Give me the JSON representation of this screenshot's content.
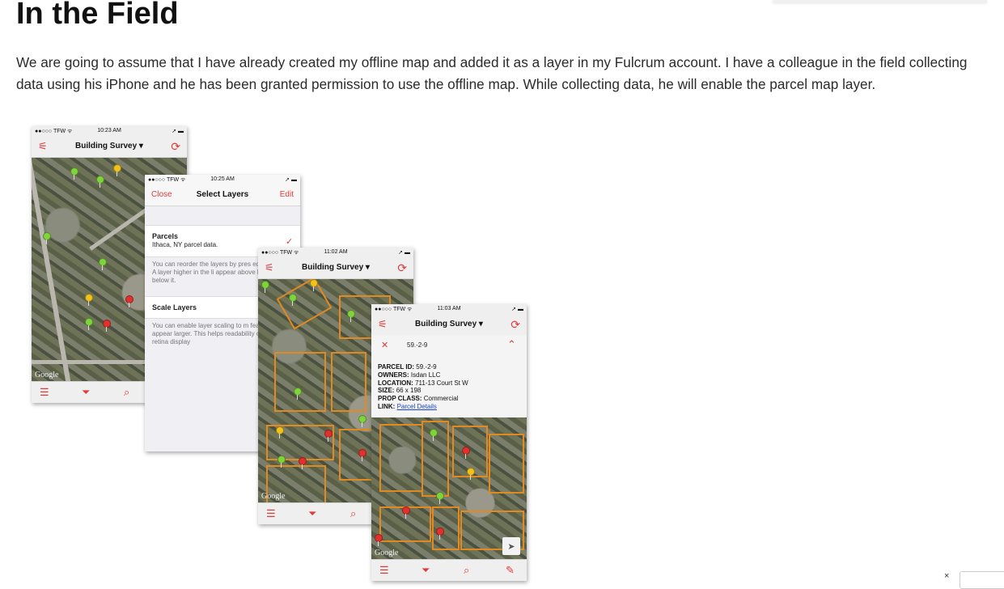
{
  "article": {
    "heading": "In the Field",
    "intro": "We are going to assume that I have already created my offline map and added it as a layer in my Fulcrum account. I have a colleague in the field collecting data using his iPhone and he has been granted permission to use the offline map. While collecting data, he will enable the parcel map layer."
  },
  "phone1": {
    "carrier": "●●○○○ TFW ᯤ",
    "time": "10:23 AM",
    "title": "Building Survey ▾",
    "google": "Google"
  },
  "phone2": {
    "carrier": "●●○○○ TFW ᯤ",
    "time": "10:25 AM",
    "close": "Close",
    "title": "Select Layers",
    "edit": "Edit",
    "layer_name": "Parcels",
    "layer_desc": "Ithaca, NY parcel data.",
    "reorder_text": "You can reorder the layers by pres edit button. A layer higher in the li appear above layers below it.",
    "scale_label": "Scale Layers",
    "scale_text": "You can enable layer scaling to m features appear larger. This helps readability of text on retina display"
  },
  "phone3": {
    "carrier": "●●○○○ TFW ᯤ",
    "time": "11:02 AM",
    "title": "Building Survey ▾",
    "google": "Google"
  },
  "phone4": {
    "carrier": "●●○○○ TFW ᯤ",
    "time": "11:03 AM",
    "title": "Building Survey ▾",
    "parcel_short": "59.-2-9",
    "parcel_id_label": "PARCEL ID:",
    "parcel_id": "59.-2-9",
    "owners_label": "OWNERS:",
    "owners": "Isdan LLC",
    "location_label": "LOCATION:",
    "location": "711-13 Court St W",
    "size_label": "SIZE:",
    "size": "66 x 198",
    "prop_label": "PROP CLASS:",
    "prop": "Commercial",
    "link_label": "LINK:",
    "link": "Parcel Details",
    "google": "Google"
  },
  "icons": {
    "settings": "⚟",
    "refresh": "⟳",
    "list": "☰",
    "filter": "⏷",
    "search": "⌕",
    "check": "✓",
    "close": "✕",
    "chevron_up": "⌃",
    "pencil": "✎",
    "locate": "➤",
    "battery": "➚ ▬"
  },
  "corner": {
    "close": "×"
  },
  "colors": {
    "accent": "#e23a3a",
    "parcel_outline": "#e08a20"
  }
}
